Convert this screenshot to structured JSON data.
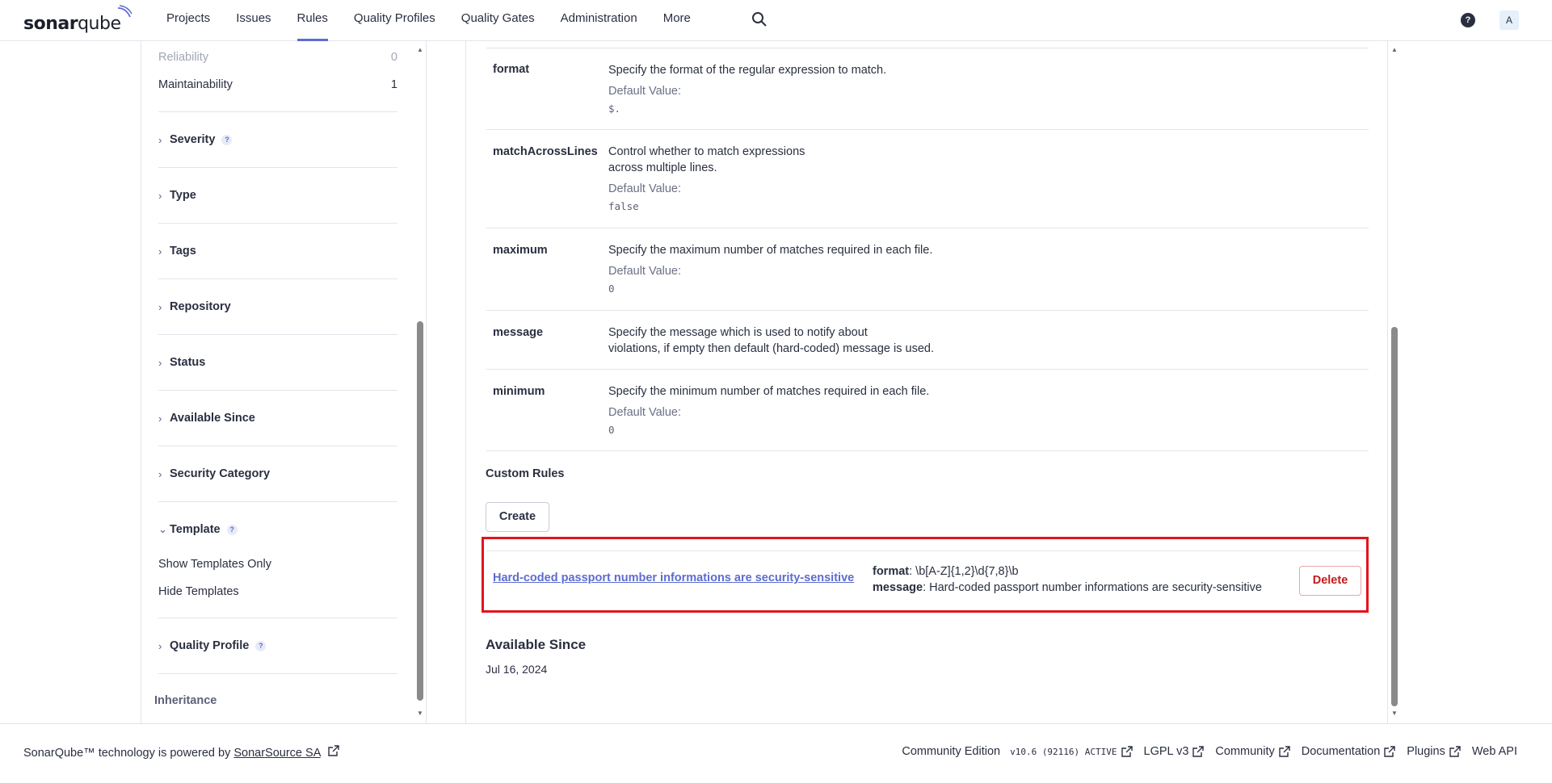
{
  "header": {
    "logo_bold": "sonar",
    "logo_light": "qube",
    "nav": [
      "Projects",
      "Issues",
      "Rules",
      "Quality Profiles",
      "Quality Gates",
      "Administration",
      "More"
    ],
    "active_nav": "Rules",
    "help_label": "?",
    "avatar_letter": "A"
  },
  "sidebar": {
    "reliability_label": "Reliability",
    "reliability_count": "0",
    "maintainability_label": "Maintainability",
    "maintainability_count": "1",
    "facets": [
      "Severity",
      "Type",
      "Tags",
      "Repository",
      "Status",
      "Available Since",
      "Security Category",
      "Template",
      "Quality Profile"
    ],
    "template_options": [
      "Show Templates Only",
      "Hide Templates"
    ],
    "inheritance_label": "Inheritance"
  },
  "parameters": [
    {
      "name": "format",
      "desc1": "Specify the format of the regular expression to match.",
      "desc2": "",
      "default_label": "Default Value:",
      "default_value": "$."
    },
    {
      "name": "matchAcrossLines",
      "desc1": "Control whether to match expressions",
      "desc2": "across multiple lines.",
      "default_label": "Default Value:",
      "default_value": "false"
    },
    {
      "name": "maximum",
      "desc1": "Specify the maximum number of matches required in each file.",
      "desc2": "",
      "default_label": "Default Value:",
      "default_value": "0"
    },
    {
      "name": "message",
      "desc1": "Specify the message which is used to notify about",
      "desc2": "violations, if empty then default (hard-coded) message is used.",
      "default_label": "",
      "default_value": ""
    },
    {
      "name": "minimum",
      "desc1": "Specify the minimum number of matches required in each file.",
      "desc2": "",
      "default_label": "Default Value:",
      "default_value": "0"
    }
  ],
  "custom_rules": {
    "title": "Custom Rules",
    "create_label": "Create",
    "rule_link": "Hard-coded passport number informations are security-sensitive",
    "format_key": "format",
    "format_value": ": \\b[A-Z]{1,2}\\d{7,8}\\b",
    "message_key": "message",
    "message_value": ": Hard-coded passport number informations are security-sensitive",
    "delete_label": "Delete"
  },
  "available_since": {
    "title": "Available Since",
    "date": "Jul 16, 2024"
  },
  "footer": {
    "left_text": "SonarQube™ technology is powered by ",
    "left_link": "SonarSource SA",
    "edition": "Community Edition",
    "version": "v10.6 (92116) ACTIVE",
    "links": [
      "LGPL v3",
      "Community",
      "Documentation",
      "Plugins"
    ],
    "web_api": "Web API"
  }
}
